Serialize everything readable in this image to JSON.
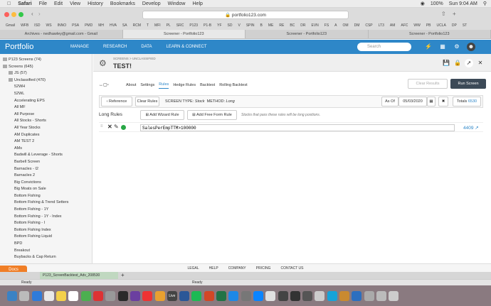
{
  "menubar": {
    "items": [
      "Safari",
      "File",
      "Edit",
      "View",
      "History",
      "Bookmarks",
      "Develop",
      "Window",
      "Help"
    ],
    "battery": "100%",
    "clock": "Sun 9:04 AM"
  },
  "browser": {
    "url": "portfolio123.com",
    "bookmarks": [
      "Gmail",
      "WFB",
      "ISD",
      "WS",
      "INNO",
      "PSA",
      "PMD",
      "MH",
      "HVA",
      "SA",
      "RCM",
      "T",
      "MFI",
      "PL",
      "SRC",
      "P123",
      "P1-B",
      "YF",
      "SD",
      "V",
      "SPIN",
      "B",
      "ME",
      "RE",
      "BC",
      "DR",
      "EVN",
      "FS",
      "A",
      "OM",
      "DM",
      "CSP",
      "LT3",
      "AM",
      "AFC",
      "WW",
      "PB",
      "UCLA",
      "DP",
      "ST"
    ],
    "tabs": [
      {
        "label": "Archives - nedhawley@gmail.com - Gmail"
      },
      {
        "label": "Screener - Portfolio123"
      },
      {
        "label": "Screener - Portfolio123"
      },
      {
        "label": "Screener - Portfolio123"
      }
    ]
  },
  "nav": {
    "logo": "Portfolio",
    "links": [
      "MANAGE",
      "RESEARCH",
      "DATA",
      "LEARN & CONNECT"
    ],
    "search_placeholder": "Search"
  },
  "sidebar": {
    "groups": [
      {
        "label": "P123 Screens (74)"
      },
      {
        "label": "Screens (645)"
      },
      {
        "label": "JS (57)"
      },
      {
        "label": "Unclassified (470)"
      }
    ],
    "items": [
      "52WH",
      "52WL",
      "Accelerating EPS",
      "All MF",
      "All Purpose",
      "All Stocks - Shorts",
      "All Year Stocks",
      "AM Duplicates",
      "AM TEST 2",
      "AMs",
      "Badwill & Leverage - Shorts",
      "Barbell Screen",
      "Barnacles - I2",
      "Barnacles 2",
      "Big Convictions",
      "Big Moats on Sale",
      "Bottom Fishing",
      "Bottom Fishing & Trend Setters",
      "Bottom Fishing - 1Y",
      "Bottom Fishing - 1Y - Index",
      "Bottom Fishing - I",
      "Bottom Fishing Index",
      "Bottom Fishing Liquid",
      "BPD",
      "Breakout",
      "Buybacks & Cap Return"
    ]
  },
  "screen": {
    "breadcrumb": "SCREENS > UNCLASSIFIED",
    "title": "TEST!",
    "clear_results": "Clear Results",
    "run_screen": "Run Screen",
    "tabs": [
      "About",
      "Settings",
      "Rules",
      "Hedge Rules",
      "Backtest",
      "Rolling Backtest"
    ],
    "active_tab": "Rules",
    "toolbar": {
      "reference": "Reference",
      "clear_rules": "Clear Rules",
      "screen_type_label": "SCREEN TYPE:",
      "screen_type": "Stock",
      "method_label": "METHOD:",
      "method": "Long",
      "as_of": "As Of",
      "date": "05/03/2020",
      "totals_label": "Totals",
      "totals": "6530"
    },
    "rules": {
      "heading": "Long Rules",
      "add_wizard": "Add Wizard Rule",
      "add_free_form": "Add Free Form Rule",
      "hint": "Stocks that pass these rules will be long positions.",
      "rows": [
        {
          "formula": "SalesPerEmpTTM>100000",
          "count": "4409"
        }
      ]
    }
  },
  "footer": {
    "links": [
      "LEGAL",
      "HELP",
      "COMPANY",
      "PRICING",
      "CONTACT US"
    ],
    "docs": "Docs"
  },
  "download": {
    "file": "P123_ScreenBacktest_Adv_208530"
  },
  "status": {
    "left": "Ready",
    "right": "Ready"
  },
  "dock": {
    "live_label": "Live"
  },
  "colors": {
    "brand": "#2e87c8",
    "run_screen": "#3c4a57",
    "docs": "#f07e26",
    "green": "#28a745"
  }
}
